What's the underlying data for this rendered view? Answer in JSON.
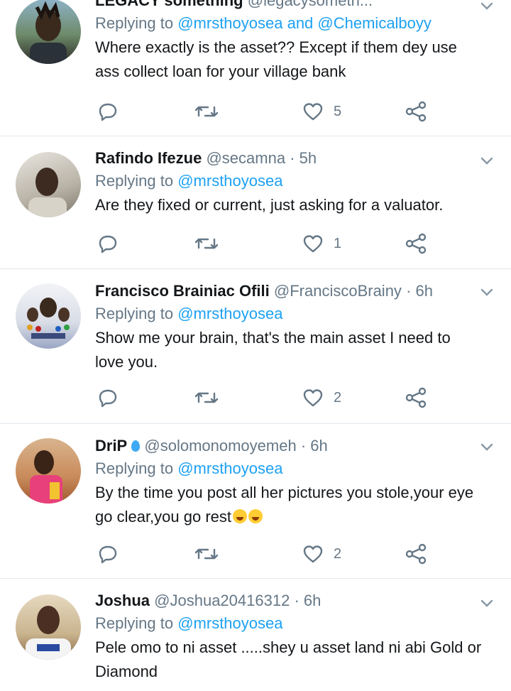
{
  "tweets": [
    {
      "name": "LEGACY something",
      "handle": "@legacysometh...",
      "time": "",
      "reply_prefix": "Replying to",
      "reply_mentions": "@mrsthoyosea and @Chemicalboyy",
      "text": "Where exactly is the asset?? Except if them dey use ass collect loan for your village bank",
      "likes": "5",
      "avatar_colors": [
        "#6e8b6a",
        "#2d2a26"
      ]
    },
    {
      "name": "Rafindo Ifezue",
      "handle": "@secamna",
      "time": "· 5h",
      "reply_prefix": "Replying to",
      "reply_mentions": "@mrsthoyosea",
      "text": "Are they fixed or  current, just asking for a valuator.",
      "likes": "1",
      "avatar_colors": [
        "#b8b2a6",
        "#3d2b22"
      ]
    },
    {
      "name": "Francisco Brainiac Ofili",
      "handle": "@FranciscoBrainy",
      "time": "· 6h",
      "reply_prefix": "Replying to",
      "reply_mentions": "@mrsthoyosea",
      "text": "Show me your brain, that's the main asset I need to love you.",
      "likes": "2",
      "avatar_colors": [
        "#d9dde6",
        "#3a4a7a"
      ]
    },
    {
      "name": "DriP",
      "handle": "@solomonomoyemeh",
      "time": "· 6h",
      "reply_prefix": "Replying to",
      "reply_mentions": "@mrsthoyosea",
      "text": "By the time you post all her pictures you stole,your eye go clear,you go rest",
      "likes": "2",
      "avatar_colors": [
        "#c98a5a",
        "#e8407a"
      ]
    },
    {
      "name": "Joshua",
      "handle": "@Joshua20416312",
      "time": "· 6h",
      "reply_prefix": "Replying to",
      "reply_mentions": "@mrsthoyosea",
      "text": "Pele omo to ni asset .....shey u asset land ni abi Gold or Diamond",
      "likes": "",
      "avatar_colors": [
        "#c9b48e",
        "#4a2f22"
      ]
    }
  ],
  "icons": {
    "reply": "reply-icon",
    "retweet": "retweet-icon",
    "like": "heart-icon",
    "share": "share-icon",
    "more": "chevron-down-icon"
  },
  "colors": {
    "link": "#1da1f2",
    "secondary": "#657786",
    "divider": "#e1e8ed"
  }
}
